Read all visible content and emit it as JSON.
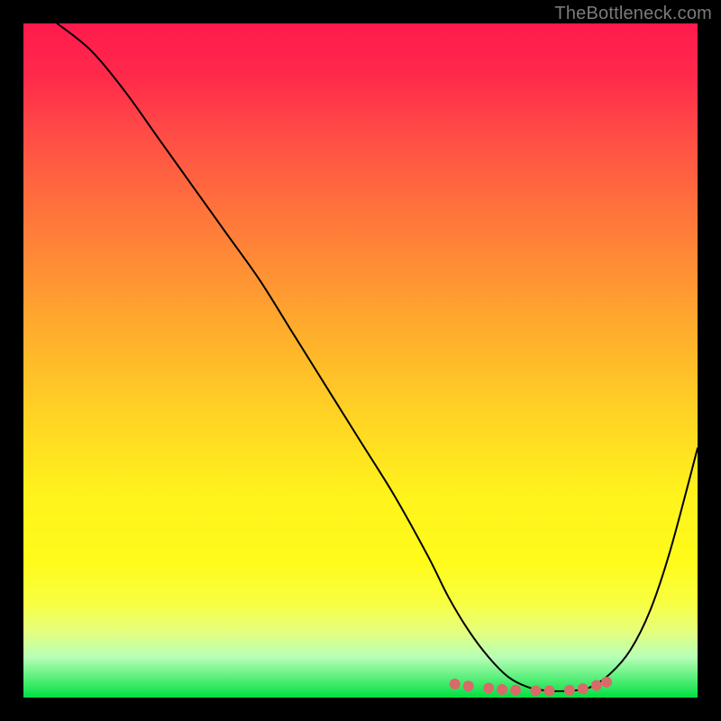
{
  "watermark": {
    "text": "TheBottleneck.com"
  },
  "chart_data": {
    "type": "line",
    "title": "",
    "xlabel": "",
    "ylabel": "",
    "xlim": [
      0,
      100
    ],
    "ylim": [
      0,
      100
    ],
    "grid": false,
    "series": [
      {
        "name": "curve",
        "x": [
          5,
          10,
          15,
          20,
          25,
          30,
          35,
          40,
          45,
          50,
          55,
          60,
          63,
          66,
          69,
          72,
          75,
          78,
          81,
          84,
          87,
          90,
          93,
          96,
          100
        ],
        "y": [
          100,
          96,
          90,
          83,
          76,
          69,
          62,
          54,
          46,
          38,
          30,
          21,
          15,
          10,
          6,
          3,
          1.5,
          1,
          1,
          1.5,
          3.5,
          7,
          13,
          22,
          37
        ],
        "color": "#000000",
        "width": 2
      }
    ],
    "markers": {
      "name": "bottom-dots",
      "color": "#d86a6a",
      "radius": 6,
      "points": [
        {
          "x": 64,
          "y": 2.0
        },
        {
          "x": 66,
          "y": 1.7
        },
        {
          "x": 69,
          "y": 1.4
        },
        {
          "x": 71,
          "y": 1.2
        },
        {
          "x": 73,
          "y": 1.1
        },
        {
          "x": 76,
          "y": 1.0
        },
        {
          "x": 78,
          "y": 1.0
        },
        {
          "x": 81,
          "y": 1.1
        },
        {
          "x": 83,
          "y": 1.3
        },
        {
          "x": 85,
          "y": 1.8
        },
        {
          "x": 86.5,
          "y": 2.3
        }
      ]
    }
  }
}
